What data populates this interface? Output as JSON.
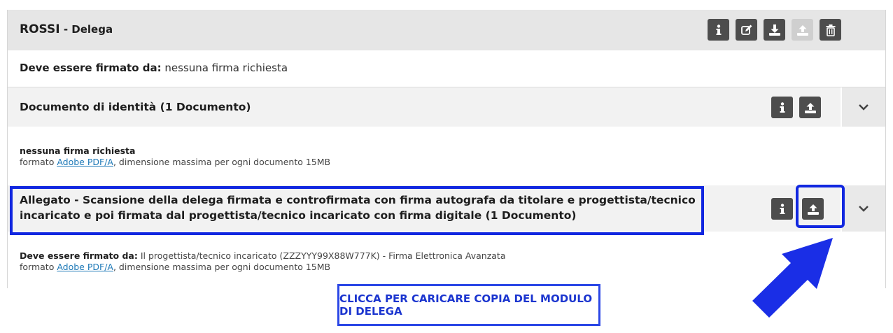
{
  "header": {
    "name": "ROSSI",
    "separator": " - ",
    "subtitle": "Delega",
    "buttons": [
      "info-icon",
      "edit-icon",
      "download-icon",
      "upload-icon",
      "trash-icon"
    ]
  },
  "signature_row": {
    "label": "Deve essere firmato da:",
    "value": " nessuna firma richiesta"
  },
  "sections": [
    {
      "title": "Documento di identità (1 Documento)",
      "requirement": "nessuna firma richiesta",
      "format_prefix": "formato ",
      "format_link": "Adobe PDF/A",
      "format_suffix": ", dimensione massima per ogni documento 15MB"
    },
    {
      "title_line1": "Allegato - Scansione della delega firmata e controfirmata con firma autografa da titolare e progettista/tecnico",
      "title_line2": "incaricato e poi firmata dal progettista/tecnico incaricato con firma digitale (1 Documento)",
      "requirement_label": "Deve essere firmato da:",
      "requirement_value": " Il progettista/tecnico incaricato  (ZZZYYY99X88W777K)  - Firma Elettronica Avanzata",
      "format_prefix": "formato ",
      "format_link": "Adobe PDF/A",
      "format_suffix": ", dimensione massima per ogni documento 15MB"
    }
  ],
  "annotation": {
    "cta_text": "CLICCA PER CARICARE COPIA DEL MODULO DI DELEGA",
    "highlight_color": "#1127e0"
  }
}
